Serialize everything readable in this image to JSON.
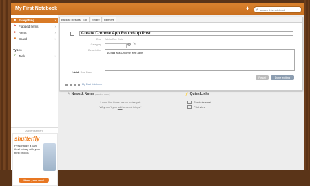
{
  "app": {
    "title": "My First Notebook",
    "add_symbol": "+",
    "search_placeholder": "search this notebook"
  },
  "sidebar": {
    "items": [
      {
        "label": "Everything",
        "active": true
      },
      {
        "label": "Flagged Items"
      },
      {
        "label": "Alerts"
      },
      {
        "label": "Board"
      }
    ],
    "types_heading": "Types",
    "types": [
      {
        "label": "Task"
      }
    ]
  },
  "ad": {
    "heading": "Advertisement",
    "logo": "shutterfly",
    "text": "Personalize a card this holiday with your best photos",
    "button": "Make your card"
  },
  "note": {
    "tabs": [
      "Back to Results",
      "Edit",
      "Share",
      "Remove"
    ],
    "title": "Create Chrome App Round-up Post",
    "due_label": "Due",
    "due_value": "Add a Due Date",
    "category_label": "Category",
    "description_label": "Description",
    "description": "10 bad ass Chrome web apps",
    "add_due": "+Add:",
    "add_due_link": "Due Date",
    "reset_button": "Reset",
    "done_button": "Done editing",
    "footer_link": "My First Notebook"
  },
  "news": {
    "title": "News & Notes",
    "subtitle": "(add a note)",
    "empty_line1": "Looks like there are no notes yet.",
    "empty_line2_prefix": "Why don't you",
    "empty_line2_link": "add",
    "empty_line2_suffix": "several things?"
  },
  "quick_links": {
    "title": "Quick Links",
    "items": [
      "Send via email",
      "Print view"
    ]
  }
}
